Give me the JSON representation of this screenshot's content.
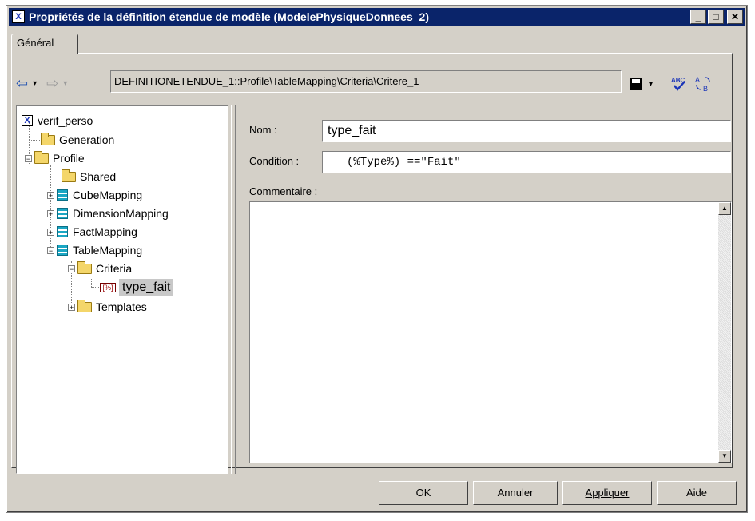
{
  "window": {
    "title": "Propriétés de la définition étendue de modèle (ModelePhysiqueDonnees_2)",
    "app_icon": "X"
  },
  "titlebar_buttons": {
    "minimize": "_",
    "maximize": "□",
    "close": "✕"
  },
  "tab": {
    "label": "Général"
  },
  "toolbar": {
    "path": "DEFINITIONETENDUE_1::Profile\\TableMapping\\Criteria\\Critere_1",
    "back_icon": "⇦",
    "forward_icon": "⇨",
    "dropdown": "▾"
  },
  "tree": {
    "root": "verif_perso",
    "items": [
      {
        "label": "Generation"
      },
      {
        "label": "Profile",
        "expander": "−"
      },
      {
        "label": "Shared"
      },
      {
        "label": "CubeMapping",
        "expander": "+"
      },
      {
        "label": "DimensionMapping",
        "expander": "+"
      },
      {
        "label": "FactMapping",
        "expander": "+"
      },
      {
        "label": "TableMapping",
        "expander": "−"
      },
      {
        "label": "Criteria",
        "expander": "−"
      },
      {
        "label": "type_fait",
        "icon_text": "[%]"
      },
      {
        "label": "Templates",
        "expander": "+"
      }
    ]
  },
  "form": {
    "nom_label": "Nom :",
    "nom_value": "type_fait",
    "condition_label": "Condition :",
    "condition_value": "(%Type%) ==\"Fait\"",
    "commentaire_label": "Commentaire :",
    "commentaire_value": ""
  },
  "buttons": {
    "ok": "OK",
    "annuler": "Annuler",
    "appliquer": "Appliquer",
    "aide": "Aide"
  },
  "colors": {
    "titlebar": "#0a246a",
    "face": "#d4d0c8",
    "selection": "#c8c8c8"
  }
}
